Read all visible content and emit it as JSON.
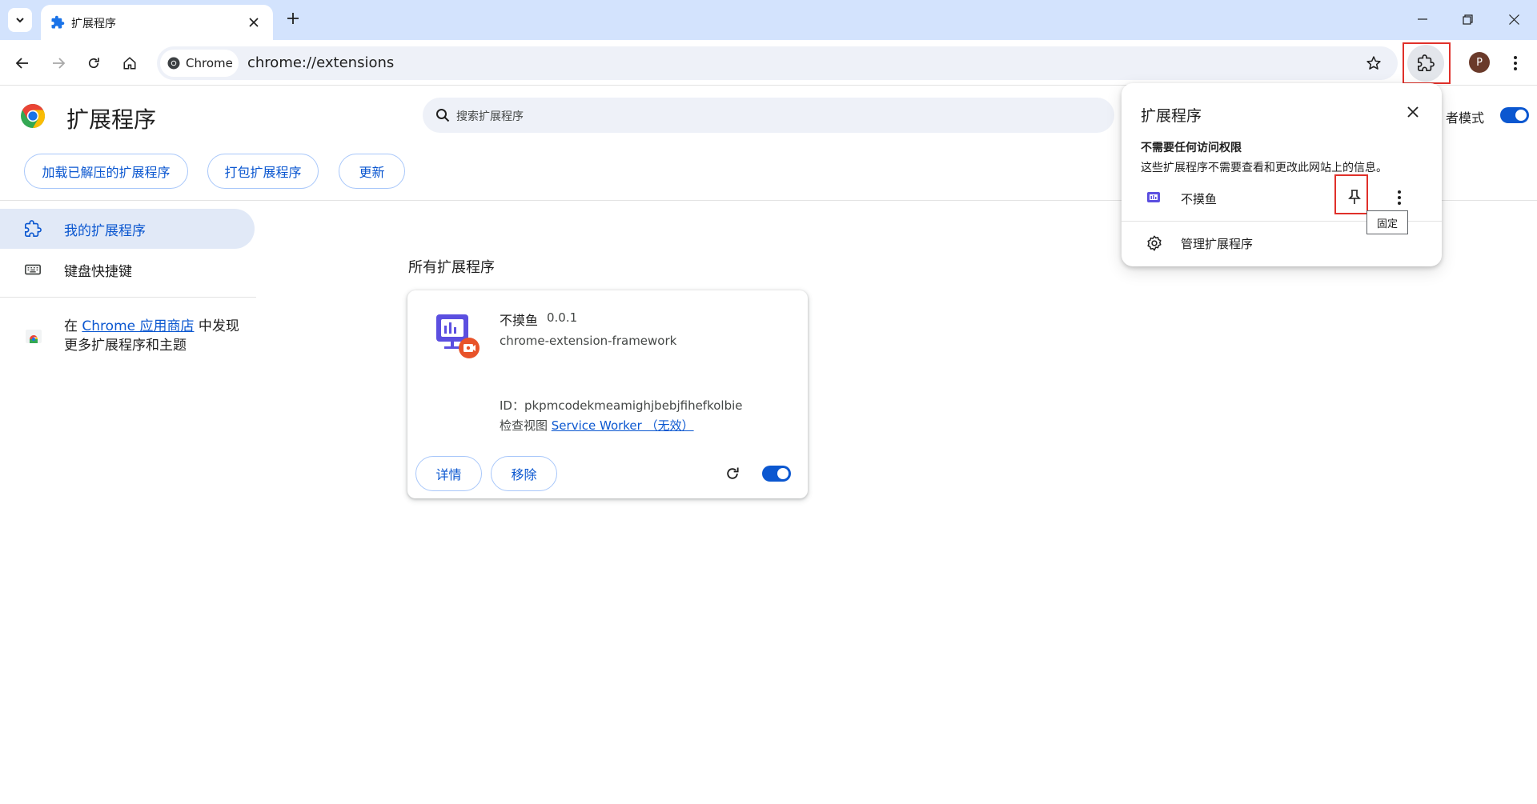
{
  "browser": {
    "tab_title": "扩展程序",
    "chip_label": "Chrome",
    "url": "chrome://extensions",
    "profile_initial": "P"
  },
  "header": {
    "title": "扩展程序",
    "search_placeholder": "搜索扩展程序",
    "dev_mode_label": "者模式",
    "dev_mode_on": true
  },
  "toolbar": {
    "load_unpacked": "加载已解压的扩展程序",
    "pack": "打包扩展程序",
    "update": "更新"
  },
  "sidebar": {
    "items": [
      {
        "label": "我的扩展程序",
        "icon": "extensions-icon",
        "active": true
      },
      {
        "label": "键盘快捷键",
        "icon": "keyboard-icon",
        "active": false
      }
    ],
    "promo_prefix": "在 ",
    "promo_link": "Chrome 应用商店",
    "promo_suffix": " 中发现更多扩展程序和主题"
  },
  "main": {
    "section_title": "所有扩展程序",
    "extension": {
      "name": "不摸鱼",
      "version": "0.0.1",
      "description": "chrome-extension-framework",
      "id_line": "ID：pkpmcodekmeamighjbebjfihefkolbie",
      "inspect_prefix": "检查视图 ",
      "inspect_link": "Service Worker （无效）",
      "details_button": "详情",
      "remove_button": "移除",
      "enabled": true
    }
  },
  "popup": {
    "title": "扩展程序",
    "section_heading": "不需要任何访问权限",
    "section_desc": "这些扩展程序不需要查看和更改此网站上的信息。",
    "extension_name": "不摸鱼",
    "pin_tooltip": "固定",
    "manage_label": "管理扩展程序"
  },
  "colors": {
    "accent": "#0b57d0",
    "tabstrip": "#d3e3fd",
    "highlight_border": "#e0302a",
    "ext_icon_purple": "#5b4fe0",
    "ext_badge_orange": "#e8532a"
  }
}
